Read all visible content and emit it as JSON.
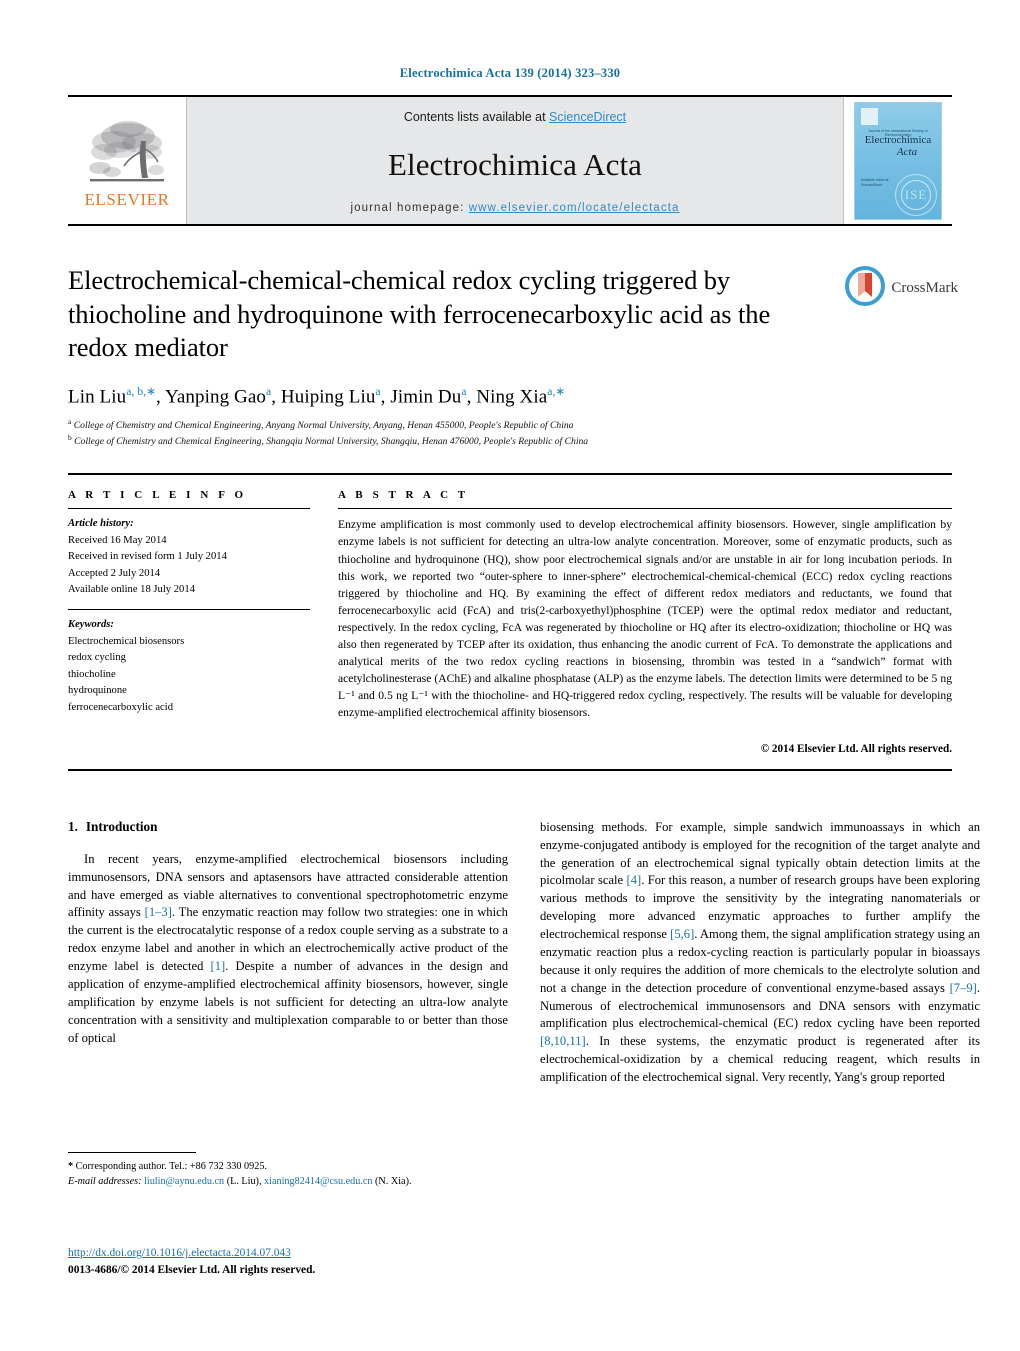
{
  "running_head": "Electrochimica Acta 139 (2014) 323–330",
  "masthead": {
    "publisher_logo_name": "elsevier-tree-logo",
    "publisher_wordmark": "ELSEVIER",
    "contents_prefix": "Contents lists available at ",
    "contents_link": "ScienceDirect",
    "journal_name": "Electrochimica Acta",
    "homepage_prefix": "journal homepage: ",
    "homepage_url": "www.elsevier.com/locate/electacta",
    "cover": {
      "tagline": "Journal of the International Society of Electrochemistry",
      "title_line1": "Electrochimica",
      "title_line2": "Acta",
      "imprint": "Available online at\nScienceDirect",
      "society_mark": "ISE"
    }
  },
  "article": {
    "title": "Electrochemical-chemical-chemical redox cycling triggered by thiocholine and hydroquinone with ferrocenecarboxylic acid as the redox mediator",
    "crossmark_label": "CrossMark",
    "authors_html": "Lin Liu<sup>a, b,∗</sup>, Yanping Gao<sup>a</sup>, Huiping Liu<sup>a</sup>, Jimin Du<sup>a</sup>, Ning Xia<sup>a,∗</sup>",
    "affiliations": [
      {
        "marker": "a",
        "text": "College of Chemistry and Chemical Engineering, Anyang Normal University, Anyang, Henan 455000, People's Republic of China"
      },
      {
        "marker": "b",
        "text": "College of Chemistry and Chemical Engineering, Shangqiu Normal University, Shangqiu, Henan 476000, People's Republic of China"
      }
    ]
  },
  "article_info": {
    "heading": "A R T I C L E   I N F O",
    "history_label": "Article history:",
    "history": [
      "Received 16 May 2014",
      "Received in revised form 1 July 2014",
      "Accepted 2 July 2014",
      "Available online 18 July 2014"
    ],
    "keywords_label": "Keywords:",
    "keywords": [
      "Electrochemical biosensors",
      "redox cycling",
      "thiocholine",
      "hydroquinone",
      "ferrocenecarboxylic acid"
    ]
  },
  "abstract": {
    "heading": "A B S T R A C T",
    "text": "Enzyme amplification is most commonly used to develop electrochemical affinity biosensors. However, single amplification by enzyme labels is not sufficient for detecting an ultra-low analyte concentration. Moreover, some of enzymatic products, such as thiocholine and hydroquinone (HQ), show poor electrochemical signals and/or are unstable in air for long incubation periods. In this work, we reported two “outer-sphere to inner-sphere” electrochemical-chemical-chemical (ECC) redox cycling reactions triggered by thiocholine and HQ. By examining the effect of different redox mediators and reductants, we found that ferrocenecarboxylic acid (FcA) and tris(2-carboxyethyl)phosphine (TCEP) were the optimal redox mediator and reductant, respectively. In the redox cycling, FcA was regenerated by thiocholine or HQ after its electro-oxidization; thiocholine or HQ was also then regenerated by TCEP after its oxidation, thus enhancing the anodic current of FcA. To demonstrate the applications and analytical merits of the two redox cycling reactions in biosensing, thrombin was tested in a “sandwich” format with acetylcholinesterase (AChE) and alkaline phosphatase (ALP) as the enzyme labels. The detection limits were determined to be 5 ng L⁻¹ and 0.5 ng L⁻¹ with the thiocholine- and HQ-triggered redox cycling, respectively. The results will be valuable for developing enzyme-amplified electrochemical affinity biosensors.",
    "copyright": "© 2014 Elsevier Ltd. All rights reserved."
  },
  "introduction": {
    "number": "1.",
    "title": "Introduction",
    "left_paragraph_html": "In recent years, enzyme-amplified electrochemical biosensors including immunosensors, DNA sensors and aptasensors have attracted considerable attention and have emerged as viable alternatives to conventional spectrophotometric enzyme affinity assays <span class=\"ref\">[1–3]</span>. The enzymatic reaction may follow two strategies: one in which the current is the electrocatalytic response of a redox couple serving as a substrate to a redox enzyme label and another in which an electrochemically active product of the enzyme label is detected <span class=\"ref\">[1]</span>. Despite a number of advances in the design and application of enzyme-amplified electrochemical affinity biosensors, however, single amplification by enzyme labels is not sufficient for detecting an ultra-low analyte concentration with a sensitivity and multiplexation comparable to or better than those of optical",
    "right_paragraph_html": "biosensing methods. For example, simple sandwich immunoassays in which an enzyme-conjugated antibody is employed for the recognition of the target analyte and the generation of an electrochemical signal typically obtain detection limits at the picolmolar scale <span class=\"ref\">[4]</span>. For this reason, a number of research groups have been exploring various methods to improve the sensitivity by the integrating nanomaterials or developing more advanced enzymatic approaches to further amplify the electrochemical response <span class=\"ref\">[5,6]</span>. Among them, the signal amplification strategy using an enzymatic reaction plus a redox-cycling reaction is particularly popular in bioassays because it only requires the addition of more chemicals to the electrolyte solution and not a change in the detection procedure of conventional enzyme-based assays <span class=\"ref\">[7–9]</span>. Numerous of electrochemical immunosensors and DNA sensors with enzymatic amplification plus electrochemical-chemical (EC) redox cycling have been reported <span class=\"ref\">[8,10,11]</span>. In these systems, the enzymatic product is regenerated after its electrochemical-oxidization by a chemical reducing reagent, which results in amplification of the electrochemical signal. Very recently, Yang's group reported"
  },
  "footnotes": {
    "corresponding_html": "<b>*</b>  Corresponding author. Tel.: +86 732 330 0925.",
    "emails_html": "<i>E-mail addresses:</i> <span class=\"fn-link\">liulin@aynu.edu.cn</span> (L. Liu), <span class=\"fn-link\">xianing82414@csu.edu.cn</span> (N. Xia)."
  },
  "footer": {
    "doi": "http://dx.doi.org/10.1016/j.electacta.2014.07.043",
    "issn": "0013-4686/© 2014 Elsevier Ltd. All rights reserved."
  },
  "colors": {
    "link_blue": "#1471a8",
    "sciencedirect_blue": "#2e8bc4",
    "elsevier_orange": "#e87722",
    "masthead_grey": "#e6e7e8"
  }
}
